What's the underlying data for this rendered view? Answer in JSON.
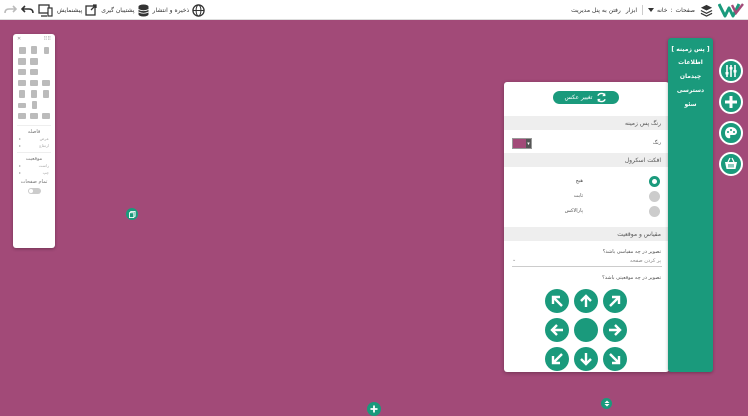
{
  "toolbar": {
    "publish": "ذخیره و انتشار",
    "backup": "پشتیبان گیری",
    "preview": "پیشنمایش",
    "pages": "صفحات",
    "page_current": "خانه",
    "tools": "ابزار",
    "admin": "رفتن به پنل مدیریت"
  },
  "tool_panel": {
    "spacing_label": "فاصله",
    "width_label": "عرض",
    "height_label": "ارتفاع",
    "position_label": "موقعیت",
    "right_label": "راست",
    "left_label": "چپ",
    "full_label": "تمام صفحات"
  },
  "settings": {
    "change_image": "تغییر عکس",
    "bg_color_section": "رنگ پس زمینه",
    "color_label": "رنگ",
    "scroll_effect_section": "افکت اسکرول",
    "scroll_options": [
      "هیچ",
      "ثابت",
      "پارالاکس"
    ],
    "selected_option": "هیچ",
    "scale_section": "مقیاس و موقعیت",
    "scale_question": "تصویر در چه مقیاسی باشد؟",
    "scale_value": "پر کردن صفحه",
    "position_question": "تصویر در چه موقعیتی باشد؟"
  },
  "menu": {
    "items": [
      "[ پس زمینه ]",
      "اطلاعات",
      "چیدمان",
      "دسترسی",
      "سئو"
    ]
  },
  "colors": {
    "canvas": "#a24a78",
    "accent": "#1a9a7c",
    "selected_color": "#a24a78"
  }
}
